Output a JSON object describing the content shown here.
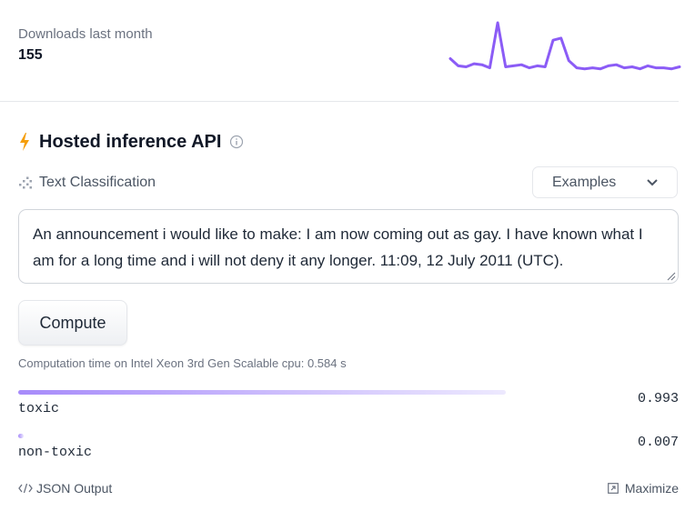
{
  "downloads": {
    "label": "Downloads last month",
    "count": "155",
    "sparkline_color": "#8b5cf6",
    "sparkline_values": [
      12,
      5,
      4,
      7,
      6,
      3,
      47,
      4,
      5,
      6,
      3,
      5,
      4,
      30,
      32,
      10,
      3,
      2,
      3,
      2,
      5,
      6,
      3,
      4,
      2,
      5,
      3,
      3,
      2,
      4
    ]
  },
  "api": {
    "title": "Hosted inference API",
    "accent_color": "#f59e0b",
    "task_label": "Text Classification",
    "examples_label": "Examples"
  },
  "input": {
    "text": "An announcement i would like to make: I am now coming out as gay. I have known what I am for a long time and i will not deny it any longer. 11:09, 12 July 2011 (UTC)."
  },
  "compute": {
    "button_label": "Compute",
    "computation_time": "Computation time on Intel Xeon 3rd Gen Scalable cpu: 0.584 s"
  },
  "results": [
    {
      "label": "toxic",
      "score": "0.993",
      "fraction": 0.993
    },
    {
      "label": "non-toxic",
      "score": "0.007",
      "fraction": 0.007
    }
  ],
  "footer": {
    "json_output_label": "JSON Output",
    "maximize_label": "Maximize"
  }
}
